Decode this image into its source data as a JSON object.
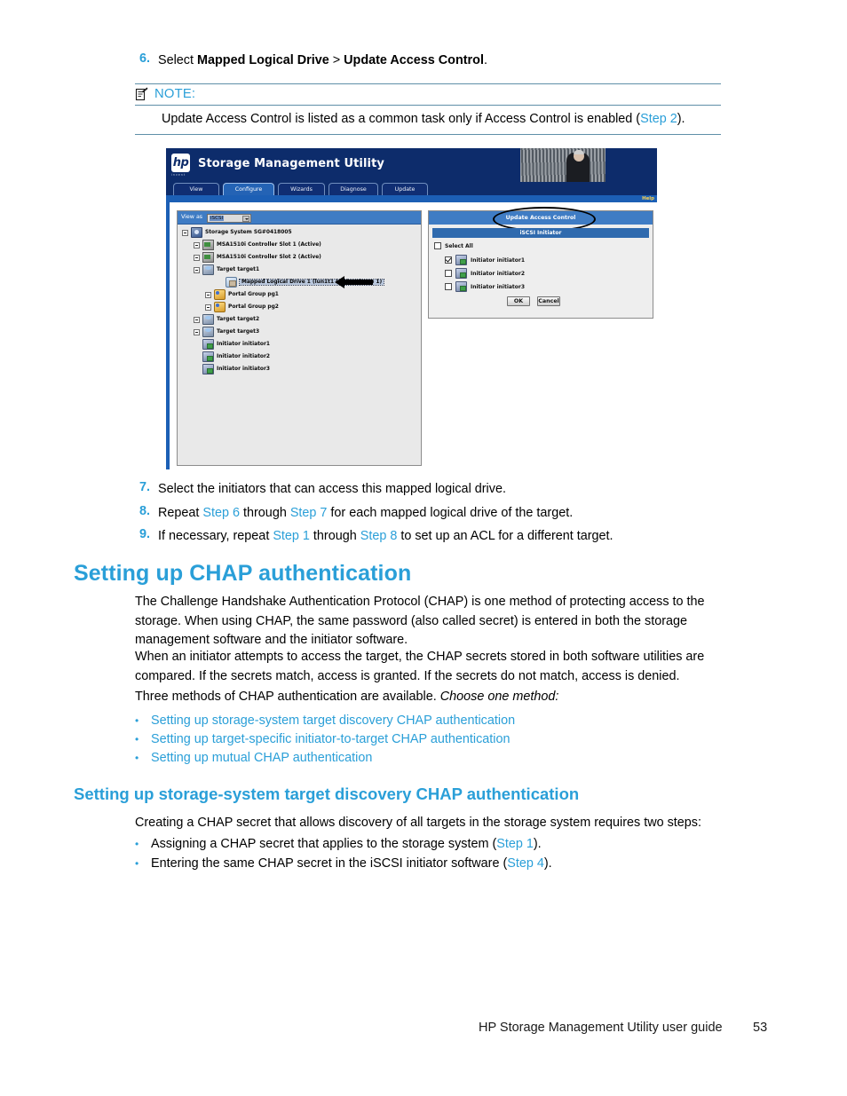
{
  "steps_top": {
    "step6": {
      "num": "6.",
      "prefix": "Select ",
      "bold1": "Mapped Logical Drive",
      "sep": " > ",
      "bold2": "Update Access Control",
      "suffix": "."
    }
  },
  "note": {
    "label": "NOTE:",
    "icon": "note-icon",
    "text_before": "Update Access Control is listed as a common task only if Access Control is enabled (",
    "link": "Step 2",
    "text_after": ")."
  },
  "screenshot": {
    "app_title": "Storage Management Utility",
    "logo_text": "hp",
    "logo_sub": "invent",
    "help_label": "Help",
    "tabs": [
      {
        "label": "View",
        "active": false
      },
      {
        "label": "Configure",
        "active": true
      },
      {
        "label": "Wizards",
        "active": false
      },
      {
        "label": "Diagnose",
        "active": false
      },
      {
        "label": "Update",
        "active": false
      }
    ],
    "tree_panel": {
      "view_as_label": "View as",
      "view_as_value": "iSCSI",
      "nodes": [
        {
          "label": "Storage System SG#0418005",
          "icon": "storage-system-icon",
          "indent": 0,
          "expander": true,
          "selected": false
        },
        {
          "label": "MSA1510i Controller Slot 1 (Active)",
          "icon": "controller-icon",
          "indent": 1,
          "expander": true,
          "selected": false
        },
        {
          "label": "MSA1510i Controller Slot 2 (Active)",
          "icon": "controller-icon",
          "indent": 1,
          "expander": true,
          "selected": false
        },
        {
          "label": "Target target1",
          "icon": "target-icon",
          "indent": 1,
          "expander": true,
          "selected": false
        },
        {
          "label": "Mapped Logical Drive 1 (lun1t1 Logical Drive 1)",
          "icon": "mapped-logical-drive-icon",
          "indent": 3,
          "expander": false,
          "selected": true
        },
        {
          "label": "Portal Group pg1",
          "icon": "portal-group-icon",
          "indent": 2,
          "expander": true,
          "selected": false
        },
        {
          "label": "Portal Group pg2",
          "icon": "portal-group-icon",
          "indent": 2,
          "expander": true,
          "selected": false
        },
        {
          "label": "Target target2",
          "icon": "target-icon",
          "indent": 1,
          "expander": true,
          "selected": false
        },
        {
          "label": "Target target3",
          "icon": "target-icon",
          "indent": 1,
          "expander": true,
          "selected": false
        },
        {
          "label": "Initiator initiator1",
          "icon": "initiator-icon",
          "indent": 1,
          "expander": false,
          "selected": false
        },
        {
          "label": "Initiator initiator2",
          "icon": "initiator-icon",
          "indent": 1,
          "expander": false,
          "selected": false
        },
        {
          "label": "Initiator initiator3",
          "icon": "initiator-icon",
          "indent": 1,
          "expander": false,
          "selected": false
        }
      ]
    },
    "dialog": {
      "title": "Update Access Control",
      "subtitle": "iSCSI Initiator",
      "select_all_label": "Select All",
      "select_all_checked": false,
      "initiators": [
        {
          "label": "Initiator initiator1",
          "checked": true
        },
        {
          "label": "Initiator initiator2",
          "checked": false
        },
        {
          "label": "Initiator initiator3",
          "checked": false
        }
      ],
      "ok_label": "OK",
      "cancel_label": "Cancel"
    }
  },
  "steps_bottom": {
    "step7": {
      "num": "7.",
      "text": "Select the initiators that can access this mapped logical drive."
    },
    "step8": {
      "num": "8.",
      "t1": "Repeat ",
      "l1": "Step 6",
      "t2": " through ",
      "l2": "Step 7",
      "t3": " for each mapped logical drive of the target."
    },
    "step9": {
      "num": "9.",
      "t1": "If necessary, repeat ",
      "l1": "Step 1",
      "t2": " through ",
      "l2": "Step 8",
      "t3": " to set up an ACL for a different target."
    }
  },
  "chap_section": {
    "heading": "Setting up CHAP authentication",
    "para1": "The Challenge Handshake Authentication Protocol (CHAP) is one method of protecting access to the storage.  When using CHAP, the same password (also called secret) is entered in both the storage management software and the initiator software.",
    "para2": "When an initiator attempts to access the target, the CHAP secrets stored in both software utilities are compared.  If the secrets match, access is granted.  If the secrets do not match, access is denied.",
    "para3_plain": "Three methods of CHAP authentication are available. ",
    "para3_italic": "Choose one method:",
    "links": [
      "Setting up storage-system target discovery CHAP authentication",
      "Setting up target-specific initiator-to-target CHAP authentication",
      "Setting up mutual CHAP authentication"
    ]
  },
  "discovery_section": {
    "heading": "Setting up storage-system target discovery CHAP authentication",
    "intro": "Creating a CHAP secret that allows discovery of all targets in the storage system requires two steps:",
    "bullets": [
      {
        "t1": "Assigning a CHAP secret that applies to the storage system (",
        "link": "Step 1",
        "t2": ")."
      },
      {
        "t1": "Entering the same CHAP secret in the iSCSI initiator software (",
        "link": "Step 4",
        "t2": ")."
      }
    ]
  },
  "footer": {
    "title": "HP Storage Management Utility user guide",
    "page": "53"
  },
  "colors": {
    "accent_blue": "#2a9fd8",
    "header_navy": "#0d2c6b",
    "panel_blue": "#3f7cc4"
  }
}
